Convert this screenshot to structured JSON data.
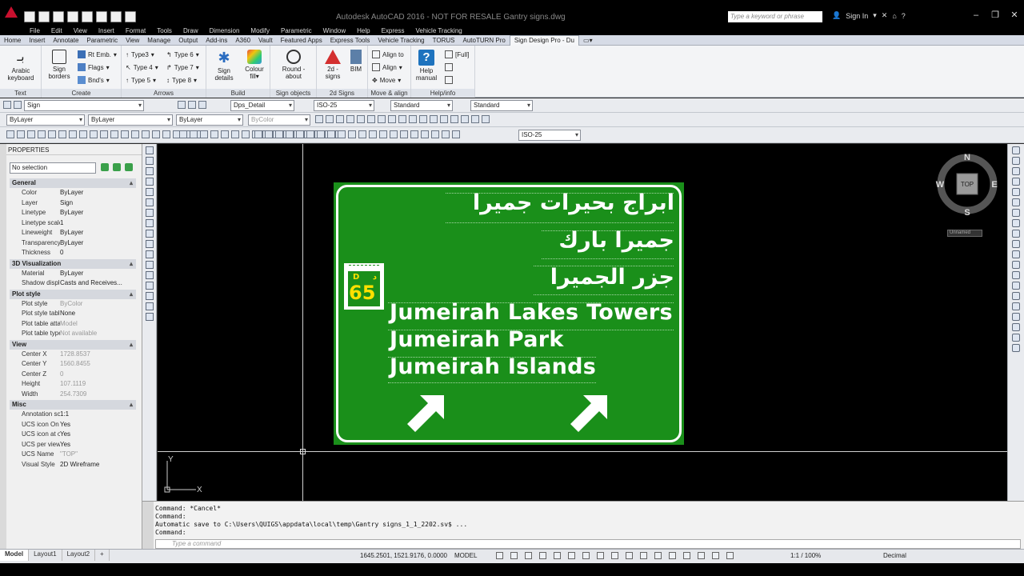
{
  "titlebar": {
    "window_title": "Autodesk AutoCAD 2016 - NOT FOR RESALE    Gantry signs.dwg",
    "search_placeholder": "Type a keyword or phrase",
    "signin_label": "Sign In"
  },
  "menu": [
    "File",
    "Edit",
    "View",
    "Insert",
    "Format",
    "Tools",
    "Draw",
    "Dimension",
    "Modify",
    "Parametric",
    "Window",
    "Help",
    "Express",
    "Vehicle Tracking"
  ],
  "ribbon_tabs": [
    "Home",
    "Insert",
    "Annotate",
    "Parametric",
    "View",
    "Manage",
    "Output",
    "Add-ins",
    "A360",
    "Vault",
    "Featured Apps",
    "Express Tools",
    "Vehicle Tracking",
    "TORUS",
    "AutoTURN Pro",
    "Sign Design Pro - Du"
  ],
  "ribbon": {
    "arabic_keyboard": "Arabic keyboard",
    "sign_borders": "Sign borders",
    "rt_emb": "Rt Emb.",
    "flags": "Flags",
    "bnds": "Bnd's",
    "type3": "Type3",
    "type4": "Type 4",
    "type5": "Type 5",
    "type6": "Type 6",
    "type7": "Type 7",
    "type8": "Type 8",
    "sign_details": "Sign details",
    "colour_fill": "Colour fill",
    "round_about": "Round -about",
    "signs_2d": "2d - signs",
    "bim": "BIM",
    "align_to": "Align to",
    "align": "Align",
    "move": "Move",
    "help_manual": "Help manual",
    "full": "[Full]",
    "groups": {
      "text": "Text",
      "create": "Create",
      "arrows": "Arrows",
      "build": "Build",
      "sign_objects": "Sign objects",
      "signs_2d": "2d Signs",
      "move_align": "Move & align",
      "help_info": "Help/info"
    }
  },
  "toolbars": {
    "layer": "Sign",
    "dimstyle": "Dps_Detail",
    "textstyle": "ISO-25",
    "tablestyle": "Standard",
    "mleaderstyle": "Standard",
    "color": "ByLayer",
    "linetype": "ByLayer",
    "lineweight": "ByLayer",
    "plotstyle": "ByColor",
    "dimstyle2": "ISO-25"
  },
  "properties": {
    "title": "PROPERTIES",
    "selection": "No selection",
    "sections": [
      {
        "name": "General",
        "rows": [
          {
            "k": "Color",
            "v": "ByLayer"
          },
          {
            "k": "Layer",
            "v": "Sign"
          },
          {
            "k": "Linetype",
            "v": "ByLayer"
          },
          {
            "k": "Linetype scale",
            "v": "1"
          },
          {
            "k": "Lineweight",
            "v": "ByLayer"
          },
          {
            "k": "Transparency",
            "v": "ByLayer"
          },
          {
            "k": "Thickness",
            "v": "0"
          }
        ]
      },
      {
        "name": "3D Visualization",
        "rows": [
          {
            "k": "Material",
            "v": "ByLayer"
          },
          {
            "k": "Shadow display",
            "v": "Casts and Receives..."
          }
        ]
      },
      {
        "name": "Plot style",
        "rows": [
          {
            "k": "Plot style",
            "v": "ByColor",
            "dis": true
          },
          {
            "k": "Plot style table",
            "v": "None"
          },
          {
            "k": "Plot table atta...",
            "v": "Model",
            "dis": true
          },
          {
            "k": "Plot table type",
            "v": "Not available",
            "dis": true
          }
        ]
      },
      {
        "name": "View",
        "rows": [
          {
            "k": "Center X",
            "v": "1728.8537",
            "dis": true
          },
          {
            "k": "Center Y",
            "v": "1560.8455",
            "dis": true
          },
          {
            "k": "Center Z",
            "v": "0",
            "dis": true
          },
          {
            "k": "Height",
            "v": "107.1119",
            "dis": true
          },
          {
            "k": "Width",
            "v": "254.7309",
            "dis": true
          }
        ]
      },
      {
        "name": "Misc",
        "rows": [
          {
            "k": "Annotation sc...",
            "v": "1:1"
          },
          {
            "k": "UCS icon On",
            "v": "Yes"
          },
          {
            "k": "UCS icon at or...",
            "v": "Yes"
          },
          {
            "k": "UCS per viewp...",
            "v": "Yes"
          },
          {
            "k": "UCS Name",
            "v": "\"TOP\"",
            "dis": true
          },
          {
            "k": "Visual Style",
            "v": "2D Wireframe"
          }
        ]
      }
    ]
  },
  "sign": {
    "arabic_lines": [
      "ابراج بحيرات جميرا",
      "جميرا بارك",
      "جزر الجميرا"
    ],
    "english_lines": [
      "Jumeirah Lakes Towers",
      "Jumeirah Park",
      "Jumeirah Islands"
    ],
    "shield_letter_left": "D",
    "shield_letter_right": "د",
    "shield_number": "65",
    "background_color": "#1a8f1a",
    "text_color": "#ffffff",
    "shield_text_color": "#ffe000"
  },
  "viewcube": {
    "n": "N",
    "s": "S",
    "e": "E",
    "w": "W",
    "face": "TOP",
    "wcs": "Unnamed"
  },
  "ucs": {
    "x": "X",
    "y": "Y"
  },
  "command": {
    "history": [
      "Command: *Cancel*",
      "Command:",
      "Automatic save to C:\\Users\\QUIGS\\appdata\\local\\temp\\Gantry signs_1_1_2202.sv$ ...",
      "Command:"
    ],
    "placeholder": "Type a command"
  },
  "status": {
    "tabs": [
      "Model",
      "Layout1",
      "Layout2",
      "+"
    ],
    "coords": "1645.2501, 1521.9176, 0.0000",
    "model": "MODEL",
    "scale": "1:1 / 100%",
    "units": "Decimal"
  }
}
